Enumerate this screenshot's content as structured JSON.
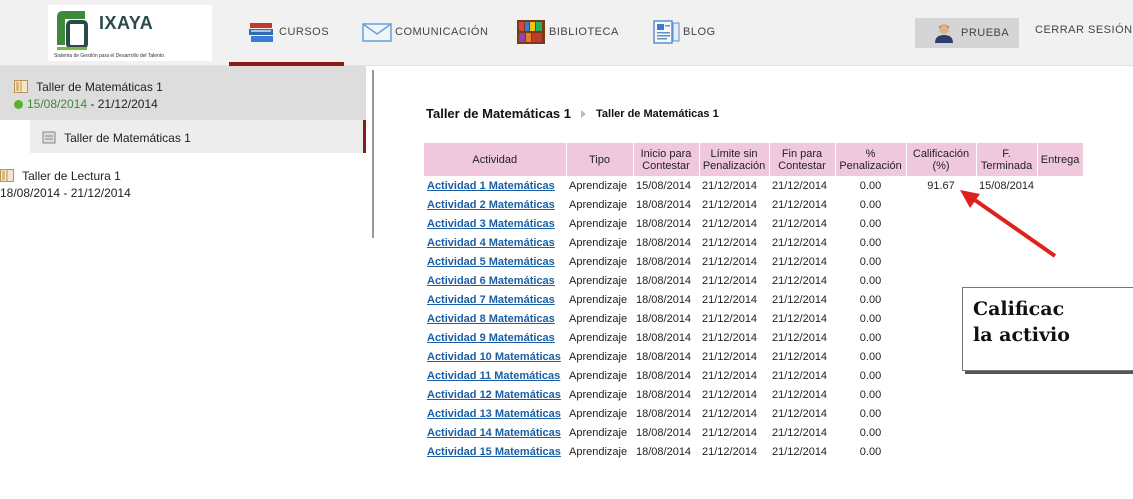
{
  "brand": {
    "name": "IXAYA",
    "tagline": "Sistema de Gestión para el Desarrollo del Talento",
    "colors": {
      "accent": "#8b1a1a",
      "header_bg": "#f1f1f1",
      "link": "#1a5fa6",
      "table_header": "#f0c8de",
      "active_dot": "#5cb030"
    }
  },
  "nav": {
    "cursos": "CURSOS",
    "comunicacion": "COMUNICACIÓN",
    "biblioteca": "BIBLIOTECA",
    "blog": "BLOG",
    "user": "PRUEBA",
    "logout": "CERRAR SESIÓN",
    "icons": [
      "books-icon",
      "envelope-icon",
      "bookshelf-icon",
      "blog-icon",
      "user-icon"
    ]
  },
  "sidebar": {
    "courses": [
      {
        "title": "Taller de Matemáticas 1",
        "start": "15/08/2014",
        "end": " - 21/12/2014",
        "active": true
      },
      {
        "title": "Taller de Lectura 1",
        "dates": "18/08/2014 - 21/12/2014"
      }
    ],
    "sub_item": "Taller de Matemáticas 1"
  },
  "breadcrumb": {
    "first": "Taller de Matemáticas 1",
    "second": "Taller de Matemáticas 1"
  },
  "table": {
    "headers": {
      "actividad": "Actividad",
      "tipo": "Tipo",
      "inicio_1": "Inicio para",
      "inicio_2": "Contestar",
      "limite_1": "Límite sin",
      "limite_2": "Penalización",
      "fin_1": "Fin para",
      "fin_2": "Contestar",
      "pen_1": "%",
      "pen_2": "Penalización",
      "cal_1": "Calificación",
      "cal_2": "(%)",
      "fterm_1": "F.",
      "fterm_2": "Terminada",
      "entrega": "Entrega"
    },
    "rows": [
      {
        "actividad": "Actividad 1 Matemáticas",
        "tipo": "Aprendizaje",
        "inicio": "15/08/2014",
        "limite": "21/12/2014",
        "fin": "21/12/2014",
        "penalizacion": "0.00",
        "calificacion": "91.67",
        "terminada": "15/08/2014",
        "entrega": ""
      },
      {
        "actividad": "Actividad 2 Matemáticas",
        "tipo": "Aprendizaje",
        "inicio": "18/08/2014",
        "limite": "21/12/2014",
        "fin": "21/12/2014",
        "penalizacion": "0.00",
        "calificacion": "",
        "terminada": "",
        "entrega": ""
      },
      {
        "actividad": "Actividad 3 Matemáticas",
        "tipo": "Aprendizaje",
        "inicio": "18/08/2014",
        "limite": "21/12/2014",
        "fin": "21/12/2014",
        "penalizacion": "0.00",
        "calificacion": "",
        "terminada": "",
        "entrega": ""
      },
      {
        "actividad": "Actividad 4 Matemáticas",
        "tipo": "Aprendizaje",
        "inicio": "18/08/2014",
        "limite": "21/12/2014",
        "fin": "21/12/2014",
        "penalizacion": "0.00",
        "calificacion": "",
        "terminada": "",
        "entrega": ""
      },
      {
        "actividad": "Actividad 5 Matemáticas",
        "tipo": "Aprendizaje",
        "inicio": "18/08/2014",
        "limite": "21/12/2014",
        "fin": "21/12/2014",
        "penalizacion": "0.00",
        "calificacion": "",
        "terminada": "",
        "entrega": ""
      },
      {
        "actividad": "Actividad 6 Matemáticas",
        "tipo": "Aprendizaje",
        "inicio": "18/08/2014",
        "limite": "21/12/2014",
        "fin": "21/12/2014",
        "penalizacion": "0.00",
        "calificacion": "",
        "terminada": "",
        "entrega": ""
      },
      {
        "actividad": "Actividad 7 Matemáticas",
        "tipo": "Aprendizaje",
        "inicio": "18/08/2014",
        "limite": "21/12/2014",
        "fin": "21/12/2014",
        "penalizacion": "0.00",
        "calificacion": "",
        "terminada": "",
        "entrega": ""
      },
      {
        "actividad": "Actividad 8 Matemáticas",
        "tipo": "Aprendizaje",
        "inicio": "18/08/2014",
        "limite": "21/12/2014",
        "fin": "21/12/2014",
        "penalizacion": "0.00",
        "calificacion": "",
        "terminada": "",
        "entrega": ""
      },
      {
        "actividad": "Actividad 9 Matemáticas",
        "tipo": "Aprendizaje",
        "inicio": "18/08/2014",
        "limite": "21/12/2014",
        "fin": "21/12/2014",
        "penalizacion": "0.00",
        "calificacion": "",
        "terminada": "",
        "entrega": ""
      },
      {
        "actividad": "Actividad 10 Matemáticas",
        "tipo": "Aprendizaje",
        "inicio": "18/08/2014",
        "limite": "21/12/2014",
        "fin": "21/12/2014",
        "penalizacion": "0.00",
        "calificacion": "",
        "terminada": "",
        "entrega": ""
      },
      {
        "actividad": "Actividad 11 Matemáticas",
        "tipo": "Aprendizaje",
        "inicio": "18/08/2014",
        "limite": "21/12/2014",
        "fin": "21/12/2014",
        "penalizacion": "0.00",
        "calificacion": "",
        "terminada": "",
        "entrega": ""
      },
      {
        "actividad": "Actividad 12 Matemáticas",
        "tipo": "Aprendizaje",
        "inicio": "18/08/2014",
        "limite": "21/12/2014",
        "fin": "21/12/2014",
        "penalizacion": "0.00",
        "calificacion": "",
        "terminada": "",
        "entrega": ""
      },
      {
        "actividad": "Actividad 13 Matemáticas",
        "tipo": "Aprendizaje",
        "inicio": "18/08/2014",
        "limite": "21/12/2014",
        "fin": "21/12/2014",
        "penalizacion": "0.00",
        "calificacion": "",
        "terminada": "",
        "entrega": ""
      },
      {
        "actividad": "Actividad 14 Matemáticas",
        "tipo": "Aprendizaje",
        "inicio": "18/08/2014",
        "limite": "21/12/2014",
        "fin": "21/12/2014",
        "penalizacion": "0.00",
        "calificacion": "",
        "terminada": "",
        "entrega": ""
      },
      {
        "actividad": "Actividad 15 Matemáticas",
        "tipo": "Aprendizaje",
        "inicio": "18/08/2014",
        "limite": "21/12/2014",
        "fin": "21/12/2014",
        "penalizacion": "0.00",
        "calificacion": "",
        "terminada": "",
        "entrega": ""
      }
    ]
  },
  "annotation": {
    "line1": "Calificac",
    "line2": "la activio",
    "arrow_color": "#e0201c"
  }
}
